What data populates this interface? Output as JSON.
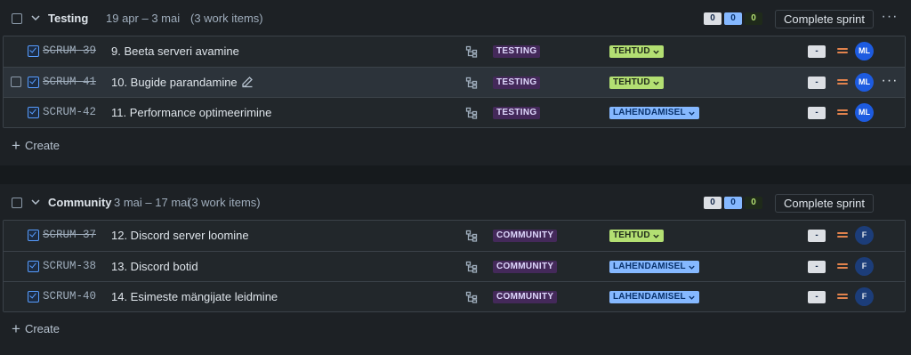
{
  "sprints": [
    {
      "name": "Testing",
      "dates": "19 apr – 3 mai",
      "work_items": "(3 work items)",
      "counts": {
        "todo": "0",
        "in_progress": "0",
        "done": "0"
      },
      "complete_label": "Complete sprint",
      "more_label": "···",
      "create_label": "Create",
      "issues": [
        {
          "key": "SCRUM-39",
          "summary": "9. Beeta serveri avamine",
          "epic": "TESTING",
          "status": "TEHTUD",
          "estimate": "-",
          "assignee": "ML"
        },
        {
          "key": "SCRUM-41",
          "summary": "10. Bugide parandamine",
          "epic": "TESTING",
          "status": "TEHTUD",
          "estimate": "-",
          "assignee": "ML",
          "row_more": "···"
        },
        {
          "key": "SCRUM-42",
          "summary": "11. Performance optimeerimine",
          "epic": "TESTING",
          "status": "LAHENDAMISEL",
          "estimate": "-",
          "assignee": "ML"
        }
      ]
    },
    {
      "name": "Community",
      "dates": "3 mai – 17 mai",
      "work_items": "(3 work items)",
      "counts": {
        "todo": "0",
        "in_progress": "0",
        "done": "0"
      },
      "complete_label": "Complete sprint",
      "more_label": "···",
      "create_label": "Create",
      "issues": [
        {
          "key": "SCRUM-37",
          "summary": "12. Discord server loomine",
          "epic": "COMMUNITY",
          "status": "TEHTUD",
          "estimate": "-",
          "assignee": "F"
        },
        {
          "key": "SCRUM-38",
          "summary": "13. Discord botid",
          "epic": "COMMUNITY",
          "status": "LAHENDAMISEL",
          "estimate": "-",
          "assignee": "F"
        },
        {
          "key": "SCRUM-40",
          "summary": "14. Esimeste mängijate leidmine",
          "epic": "COMMUNITY",
          "status": "LAHENDAMISEL",
          "estimate": "-",
          "assignee": "F"
        }
      ]
    }
  ],
  "colors": {
    "background": "#1d2125",
    "row": "#22272b",
    "epic_bg": "#44295a",
    "status_done": "#b3df72",
    "status_in_progress": "#85b8ff",
    "priority_medium": "#e2834d",
    "avatar_ml": "#1d5be0",
    "avatar_f": "#1c3d79"
  },
  "icons": {
    "collapse": "chevron-down-icon",
    "issue_type": "task-checkbox-icon",
    "hierarchy": "child-issues-icon",
    "priority": "priority-medium-icon",
    "edit": "pencil-icon",
    "create": "plus-icon"
  }
}
